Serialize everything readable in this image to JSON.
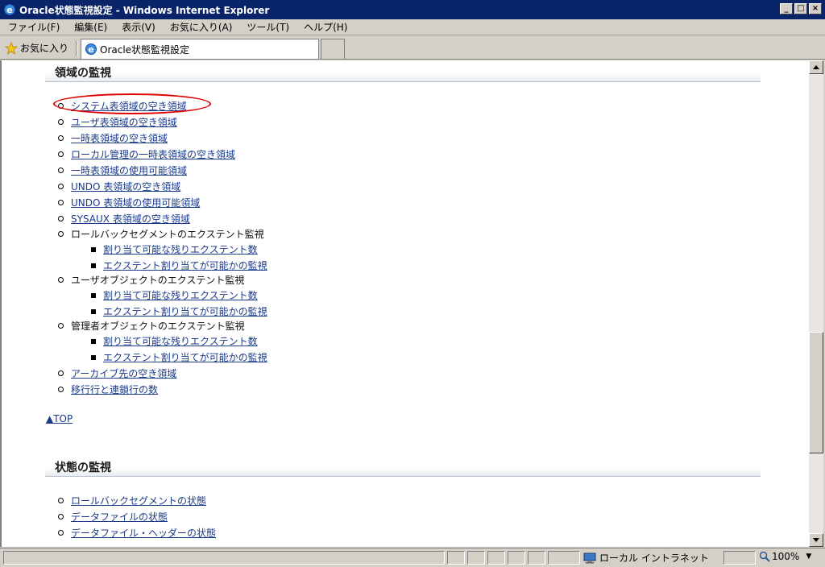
{
  "window": {
    "title": "Oracle状態監視設定 - Windows Internet Explorer",
    "controls": [
      "_",
      "□",
      "×"
    ]
  },
  "menu": [
    "ファイル(F)",
    "編集(E)",
    "表示(V)",
    "お気に入り(A)",
    "ツール(T)",
    "ヘルプ(H)"
  ],
  "favorites": {
    "label": "お気に入り",
    "tab_title": "Oracle状態監視設定"
  },
  "sections": {
    "area": {
      "heading": "領域の監視",
      "items": [
        "システム表領域の空き領域",
        "ユーザ表領域の空き領域",
        "一時表領域の空き領域",
        "ローカル管理の一時表領域の空き領域",
        "一時表領域の使用可能領域",
        "UNDO 表領域の空き領域",
        "UNDO 表領域の使用可能領域",
        "SYSAUX 表領域の空き領域"
      ],
      "group_rollback": {
        "label": "ロールバックセグメントのエクステント監視",
        "sub": [
          "割り当て可能な残りエクステント数",
          "エクステント割り当てが可能かの監視"
        ]
      },
      "group_user": {
        "label": "ユーザオブジェクトのエクステント監視",
        "sub": [
          "割り当て可能な残りエクステント数",
          "エクステント割り当てが可能かの監視"
        ]
      },
      "group_admin": {
        "label": "管理者オブジェクトのエクステント監視",
        "sub": [
          "割り当て可能な残りエクステント数",
          "エクステント割り当てが可能かの監視"
        ]
      },
      "tail_items": [
        "アーカイブ先の空き領域",
        "移行行と連鎖行の数"
      ],
      "top_link": "▲TOP"
    },
    "status": {
      "heading": "状態の監視",
      "items": [
        "ロールバックセグメントの状態",
        "データファイルの状態",
        "データファイル・ヘッダーの状態"
      ]
    }
  },
  "statusbar": {
    "zone": "ローカル イントラネット",
    "zoom": "100%"
  },
  "icons": {
    "ie": "ie-icon",
    "favorites": "star-icon",
    "zone": "intranet-icon",
    "zoom": "zoom-icon"
  },
  "colors": {
    "link": "#1a3a8a",
    "highlight": "#e00000",
    "titlebar": "#0a246a"
  }
}
